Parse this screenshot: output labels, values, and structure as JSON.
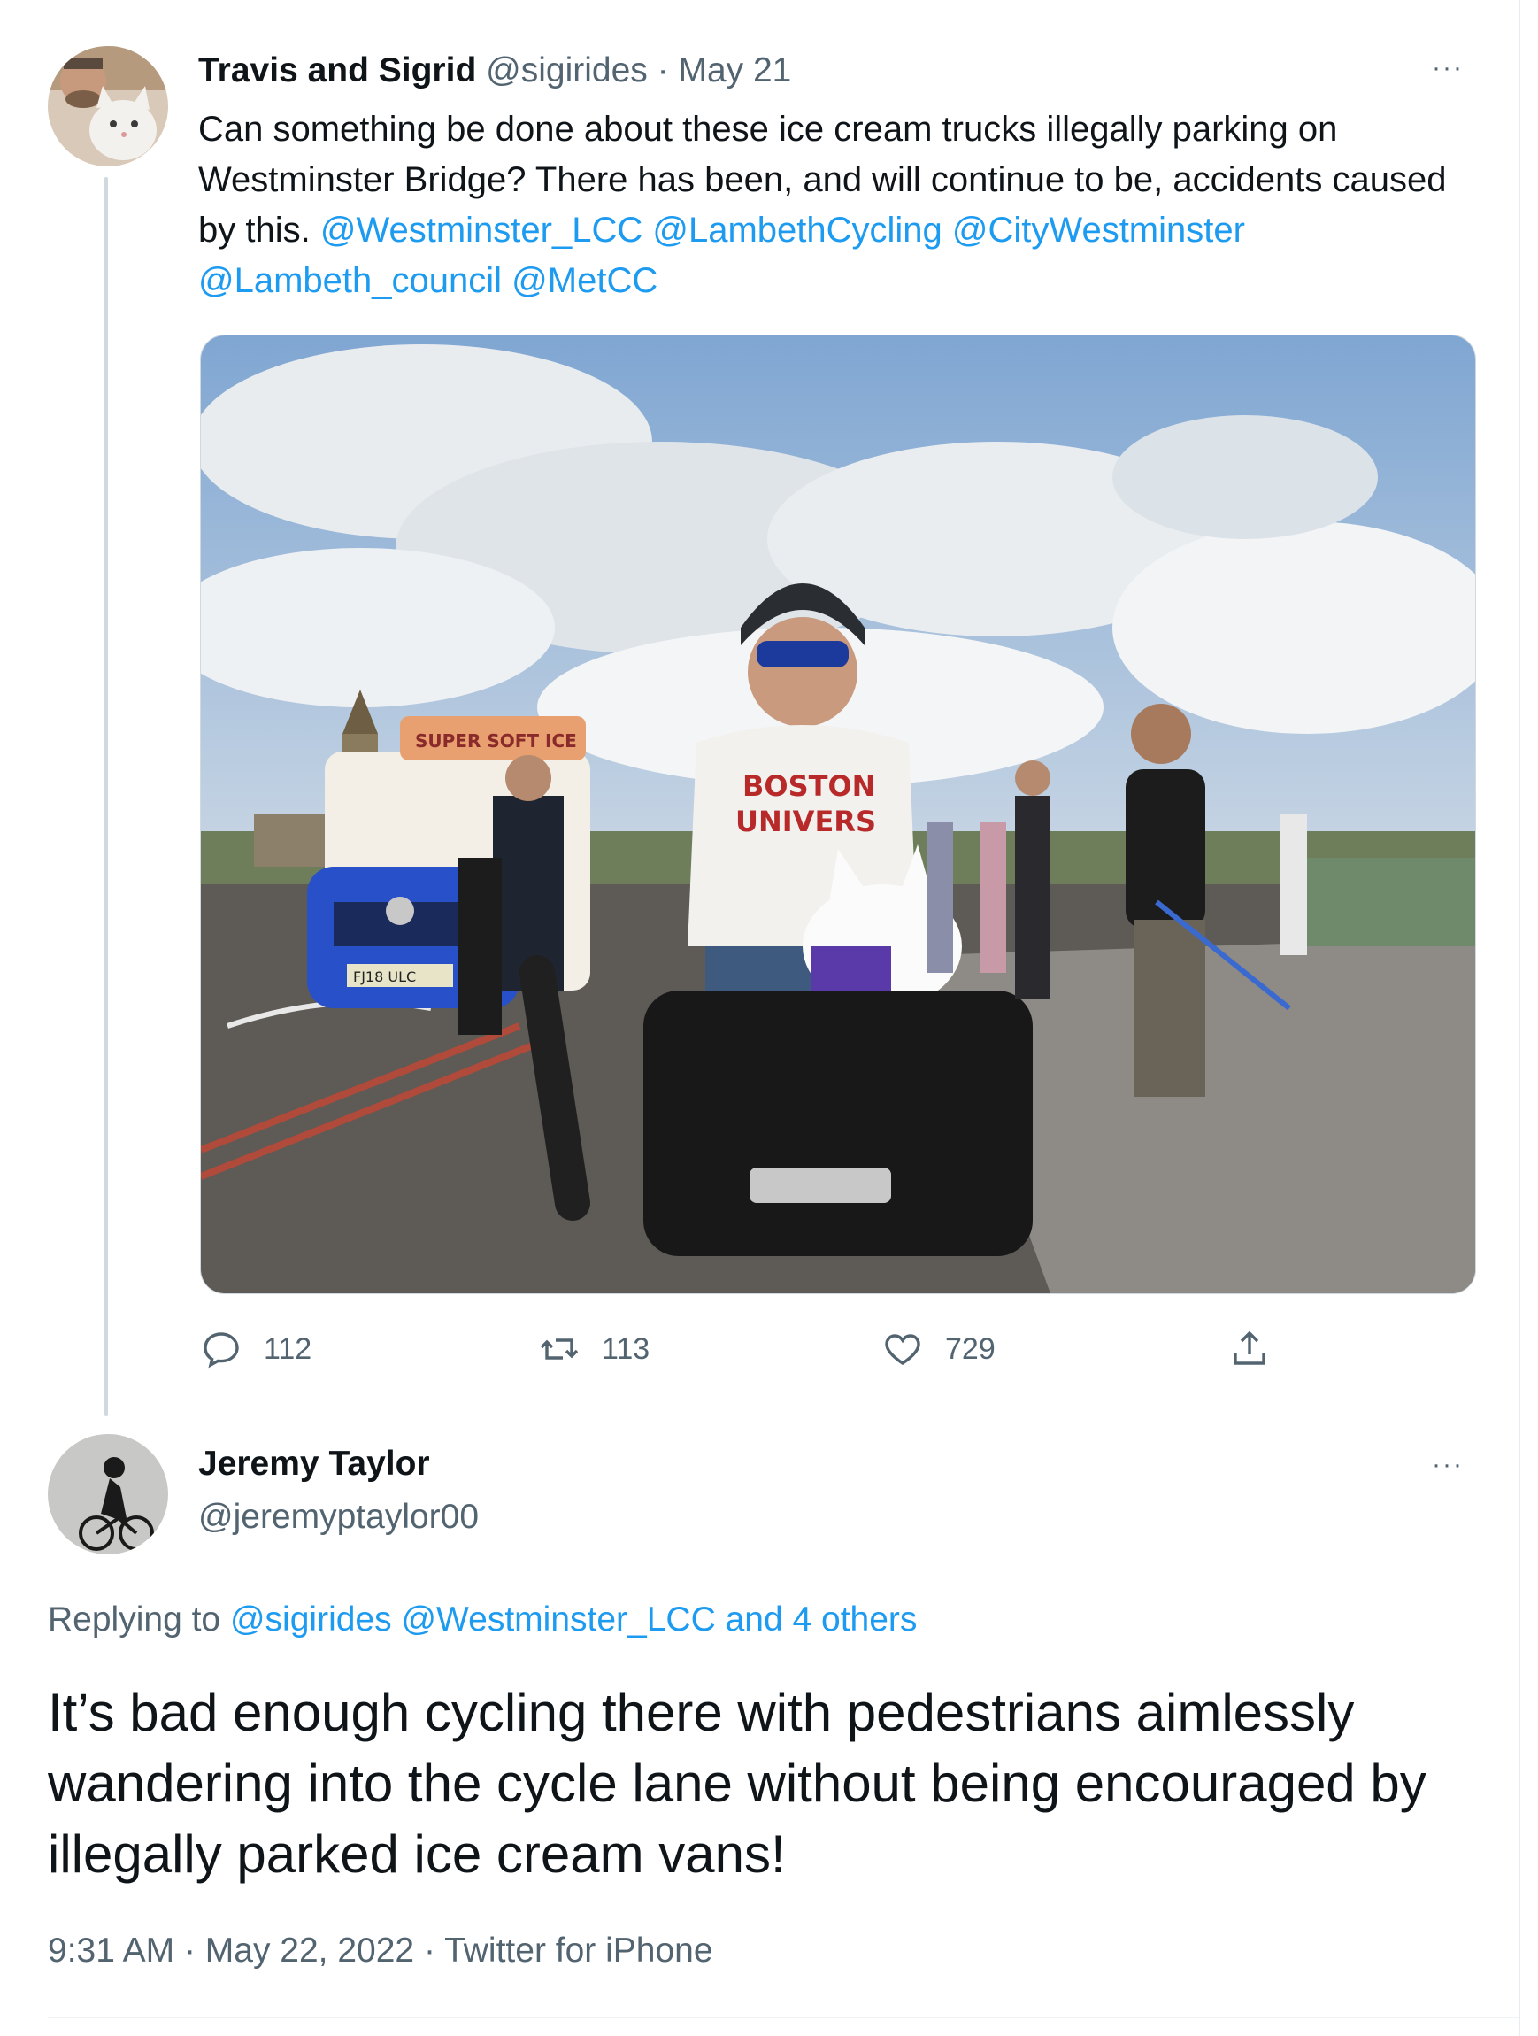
{
  "original_tweet": {
    "author_name": "Travis and Sigrid",
    "handle": "@sigirides",
    "dot": "·",
    "date": "May 21",
    "text": "Can something be done about these ice cream trucks illegally parking on Westminster Bridge? There has been, and will continue to be, accidents caused by this.",
    "mentions": [
      "@Westminster_LCC",
      "@LambethCycling",
      "@CityWestminster",
      "@Lambeth_council",
      "@MetCC"
    ],
    "media": {
      "truck_sign": "SUPER SOFT ICE",
      "plate": "FJ18 ULC",
      "shirt_line1": "BOSTON",
      "shirt_line2": "UNIVERS"
    },
    "reply_count": "112",
    "retweet_count": "113",
    "like_count": "729",
    "more_label": "···"
  },
  "reply_tweet": {
    "author_name": "Jeremy Taylor",
    "handle": "@jeremyptaylor00",
    "replying_prefix": "Replying to",
    "replying_handles": "@sigirides @Westminster_LCC",
    "replying_others": "and 4 others",
    "text": "It’s bad enough cycling there with pedestrians aimlessly wandering into the cycle lane without being encouraged by illegally parked ice cream vans!",
    "time": "9:31 AM",
    "date": "May 22, 2022",
    "source": "Twitter for iPhone",
    "dot": "·",
    "more_label": "···"
  },
  "colors": {
    "link": "#1d9bf0",
    "muted": "#536471",
    "text": "#0f1419",
    "thread_line": "#cfd9de"
  },
  "icons": [
    "reply-icon",
    "retweet-icon",
    "like-icon",
    "share-icon",
    "more-icon"
  ]
}
